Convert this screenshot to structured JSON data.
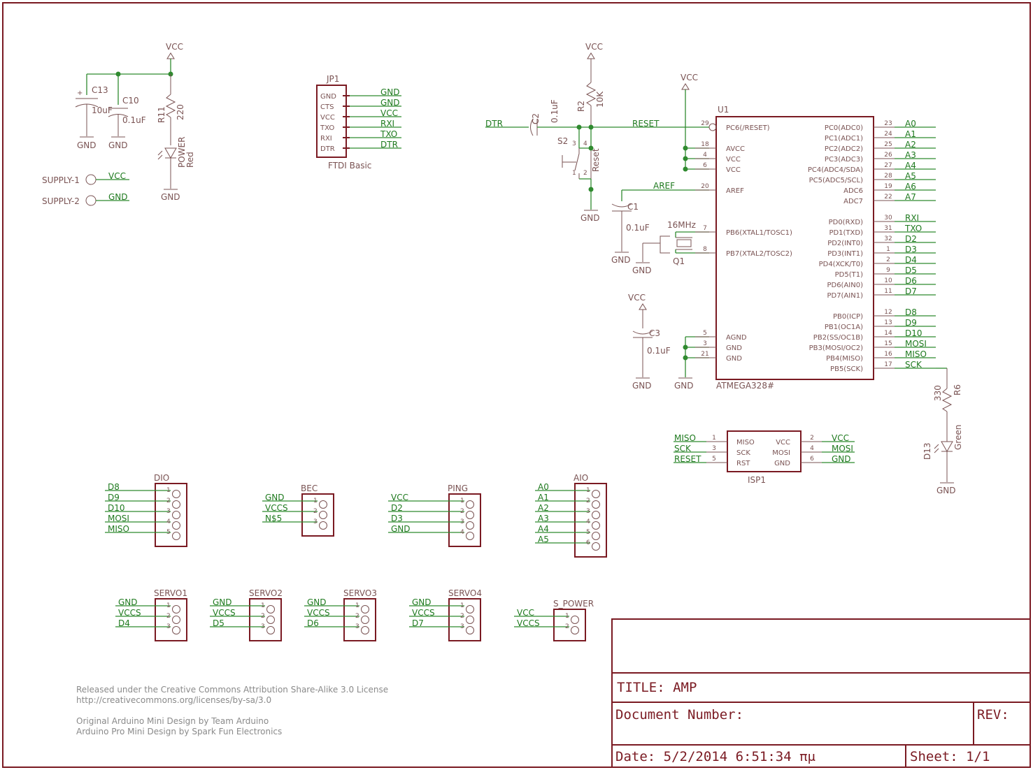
{
  "title_block": {
    "title": "TITLE: AMP",
    "doc_number": "Document Number:",
    "rev": "REV:",
    "date": "Date: 5/2/2014 6:51:34 πμ",
    "sheet": "Sheet: 1/1"
  },
  "notes": [
    "Released under the Creative Commons Attribution Share-Alike 3.0 License",
    "http://creativecommons.org/licenses/by-sa/3.0",
    "Original Arduino Mini Design by Team Arduino",
    "Arduino Pro Mini Design by Spark Fun Electronics"
  ],
  "power": {
    "c13": "C13",
    "c13_val": "10uF",
    "c10": "C10",
    "c10_val": "0.1uF",
    "r11": "R11",
    "r11_val": "220",
    "led": "POWER",
    "led_color": "Red",
    "vcc": "VCC",
    "gnd": "GND",
    "supply1": "SUPPLY-1",
    "supply2": "SUPPLY-2"
  },
  "jp1": {
    "name": "JP1",
    "value": "FTDI Basic",
    "pins": [
      "GND",
      "CTS",
      "VCC",
      "TXO",
      "RXI",
      "DTR"
    ],
    "nets": [
      "GND",
      "GND",
      "VCC",
      "RXI",
      "TXO",
      "DTR"
    ]
  },
  "reset": {
    "c2": "C2",
    "c2_val": "0.1uF",
    "r2": "R2",
    "r2_val": "10K",
    "s2": "S2",
    "s2_val": "Reset",
    "dtr": "DTR",
    "reset": "RESET",
    "s2_pins": [
      "3",
      "4",
      "1",
      "2"
    ]
  },
  "u1": {
    "name": "U1",
    "value": "ATMEGA328#",
    "left": [
      {
        "num": "29",
        "name": "PC6(/RESET)"
      },
      {
        "num": "18",
        "name": "AVCC"
      },
      {
        "num": "4",
        "name": "VCC"
      },
      {
        "num": "6",
        "name": "VCC"
      },
      {
        "num": "20",
        "name": "AREF"
      },
      {
        "num": "7",
        "name": "PB6(XTAL1/TOSC1)"
      },
      {
        "num": "8",
        "name": "PB7(XTAL2/TOSC2)"
      },
      {
        "num": "5",
        "name": "AGND"
      },
      {
        "num": "3",
        "name": "GND"
      },
      {
        "num": "21",
        "name": "GND"
      }
    ],
    "right": [
      {
        "num": "23",
        "name": "PC0(ADC0)",
        "net": "A0"
      },
      {
        "num": "24",
        "name": "PC1(ADC1)",
        "net": "A1"
      },
      {
        "num": "25",
        "name": "PC2(ADC2)",
        "net": "A2"
      },
      {
        "num": "26",
        "name": "PC3(ADC3)",
        "net": "A3"
      },
      {
        "num": "27",
        "name": "PC4(ADC4/SDA)",
        "net": "A4"
      },
      {
        "num": "28",
        "name": "PC5(ADC5/SCL)",
        "net": "A5"
      },
      {
        "num": "19",
        "name": "ADC6",
        "net": "A6"
      },
      {
        "num": "22",
        "name": "ADC7",
        "net": "A7"
      },
      {
        "num": "30",
        "name": "PD0(RXD)",
        "net": "RXI"
      },
      {
        "num": "31",
        "name": "PD1(TXD)",
        "net": "TXO"
      },
      {
        "num": "32",
        "name": "PD2(INT0)",
        "net": "D2"
      },
      {
        "num": "1",
        "name": "PD3(INT1)",
        "net": "D3"
      },
      {
        "num": "2",
        "name": "PD4(XCK/T0)",
        "net": "D4"
      },
      {
        "num": "9",
        "name": "PD5(T1)",
        "net": "D5"
      },
      {
        "num": "10",
        "name": "PD6(AIN0)",
        "net": "D6"
      },
      {
        "num": "11",
        "name": "PD7(AIN1)",
        "net": "D7"
      },
      {
        "num": "12",
        "name": "PB0(ICP)",
        "net": "D8"
      },
      {
        "num": "13",
        "name": "PB1(OC1A)",
        "net": "D9"
      },
      {
        "num": "14",
        "name": "PB2(SS/OC1B)",
        "net": "D10"
      },
      {
        "num": "15",
        "name": "PB3(MOSI/OC2)",
        "net": "MOSI"
      },
      {
        "num": "16",
        "name": "PB4(MISO)",
        "net": "MISO"
      },
      {
        "num": "17",
        "name": "PB5(SCK)",
        "net": "SCK"
      }
    ]
  },
  "misc": {
    "aref": "AREF",
    "c1": "C1",
    "c1_val": "0.1uF",
    "q1": "Q1",
    "q1_val": "16MHz",
    "c3": "C3",
    "c3_val": "0.1uF",
    "r6": "R6",
    "r6_val": "330",
    "d13": "D13",
    "d13_color": "Green"
  },
  "isp": {
    "name": "ISP1",
    "left": [
      {
        "num": "1",
        "name": "MISO",
        "net": "MISO"
      },
      {
        "num": "3",
        "name": "SCK",
        "net": "SCK"
      },
      {
        "num": "5",
        "name": "RST",
        "net": "RESET"
      }
    ],
    "right": [
      {
        "num": "2",
        "name": "VCC",
        "net": "VCC"
      },
      {
        "num": "4",
        "name": "MOSI",
        "net": "MOSI"
      },
      {
        "num": "6",
        "name": "GND",
        "net": "GND"
      }
    ]
  },
  "headers": [
    {
      "name": "DIO",
      "nets": [
        "D8",
        "D9",
        "D10",
        "MOSI",
        "MISO"
      ]
    },
    {
      "name": "BEC",
      "nets": [
        "GND",
        "VCCS",
        "N$5"
      ]
    },
    {
      "name": "PING",
      "nets": [
        "VCC",
        "D2",
        "D3",
        "GND"
      ]
    },
    {
      "name": "AIO",
      "nets": [
        "A0",
        "A1",
        "A2",
        "A3",
        "A4",
        "A5"
      ]
    },
    {
      "name": "SERVO1",
      "nets": [
        "GND",
        "VCCS",
        "D4"
      ]
    },
    {
      "name": "SERVO2",
      "nets": [
        "GND",
        "VCCS",
        "D5"
      ]
    },
    {
      "name": "SERVO3",
      "nets": [
        "GND",
        "VCCS",
        "D6"
      ]
    },
    {
      "name": "SERVO4",
      "nets": [
        "GND",
        "VCCS",
        "D7"
      ]
    },
    {
      "name": "S_POWER",
      "nets": [
        "VCC",
        "VCCS"
      ]
    }
  ]
}
